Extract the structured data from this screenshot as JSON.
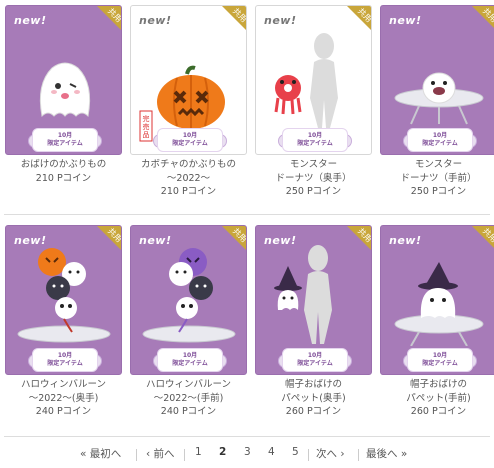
{
  "items": [
    {
      "new": "new!",
      "tag": "共用",
      "limited_line1": "10月",
      "limited_line2": "限定アイテム",
      "name_line1": "おばけのかぶりもの",
      "name_line2": "",
      "price": "210 Pコイン",
      "bg": "#a77bb8",
      "icon": "ghost-hood-icon"
    },
    {
      "new": "new!",
      "tag": "共用",
      "limited_line1": "10月",
      "limited_line2": "限定アイテム",
      "name_line1": "カボチャのかぶりもの",
      "name_line2": "〜2022〜",
      "price": "210 Pコイン",
      "bg": "#ffffff",
      "icon": "pumpkin-hood-icon",
      "stamp": "完売品"
    },
    {
      "new": "new!",
      "tag": "共用",
      "limited_line1": "10月",
      "limited_line2": "限定アイテム",
      "name_line1": "モンスター",
      "name_line2": "ドーナツ（奥手）",
      "price": "250 Pコイン",
      "bg": "#ffffff",
      "icon": "monster-donut-back-icon"
    },
    {
      "new": "new!",
      "tag": "共用",
      "limited_line1": "10月",
      "limited_line2": "限定アイテム",
      "name_line1": "モンスター",
      "name_line2": "ドーナツ（手前）",
      "price": "250 Pコイン",
      "bg": "#a77bb8",
      "icon": "monster-donut-front-icon"
    },
    {
      "new": "new!",
      "tag": "共用",
      "limited_line1": "10月",
      "limited_line2": "限定アイテム",
      "name_line1": "ハロウィンバルーン",
      "name_line2": "〜2022〜(奥手)",
      "price": "240 Pコイン",
      "bg": "#a77bb8",
      "icon": "halloween-balloon-back-icon"
    },
    {
      "new": "new!",
      "tag": "共用",
      "limited_line1": "10月",
      "limited_line2": "限定アイテム",
      "name_line1": "ハロウィンバルーン",
      "name_line2": "〜2022〜(手前)",
      "price": "240 Pコイン",
      "bg": "#a77bb8",
      "icon": "halloween-balloon-front-icon"
    },
    {
      "new": "new!",
      "tag": "共用",
      "limited_line1": "10月",
      "limited_line2": "限定アイテム",
      "name_line1": "帽子おばけの",
      "name_line2": "パペット(奥手)",
      "price": "260 Pコイン",
      "bg": "#a77bb8",
      "icon": "hat-ghost-puppet-back-icon"
    },
    {
      "new": "new!",
      "tag": "共用",
      "limited_line1": "10月",
      "limited_line2": "限定アイテム",
      "name_line1": "帽子おばけの",
      "name_line2": "パペット(手前)",
      "price": "260 Pコイン",
      "bg": "#a77bb8",
      "icon": "hat-ghost-puppet-front-icon"
    }
  ],
  "pagination": {
    "first": "« 最初へ",
    "prev": "‹ 前へ",
    "pages": [
      "1",
      "2",
      "3",
      "4",
      "5"
    ],
    "current": "2",
    "next": "次へ ›",
    "last": "最後へ »"
  },
  "colors": {
    "purple_card": "#a77bb8",
    "gold_tag": "#c9a63a",
    "text": "#555555"
  }
}
